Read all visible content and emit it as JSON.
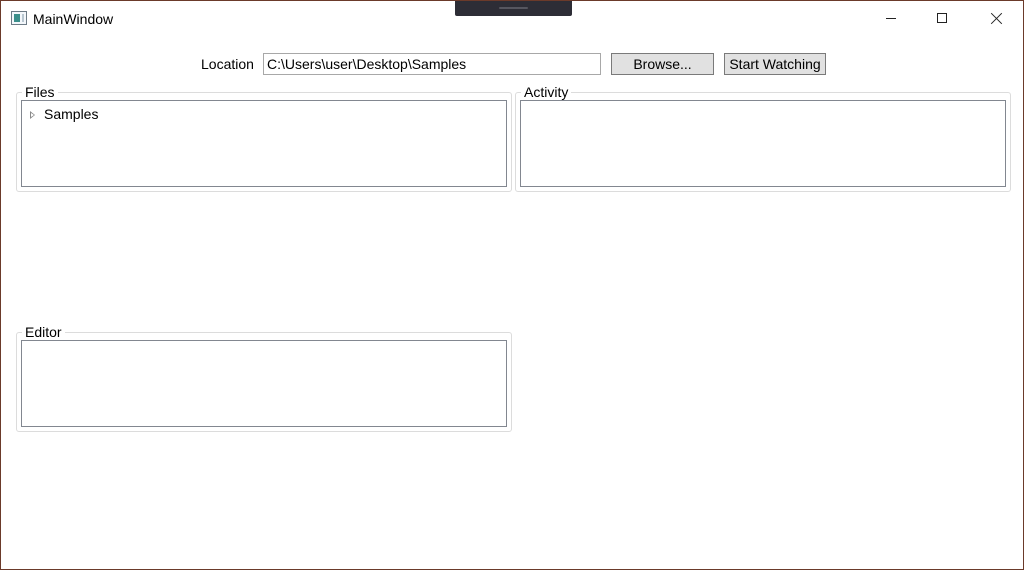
{
  "window": {
    "title": "MainWindow",
    "controls": [
      "minimize-icon",
      "maximize-icon",
      "close-icon"
    ]
  },
  "location": {
    "label": "Location",
    "value": "C:\\Users\\user\\Desktop\\Samples",
    "browse_label": "Browse...",
    "watch_label": "Start Watching"
  },
  "files": {
    "header": "Files",
    "tree": [
      {
        "label": "Samples",
        "expanded": false
      }
    ]
  },
  "activity": {
    "header": "Activity"
  },
  "editor": {
    "header": "Editor"
  }
}
